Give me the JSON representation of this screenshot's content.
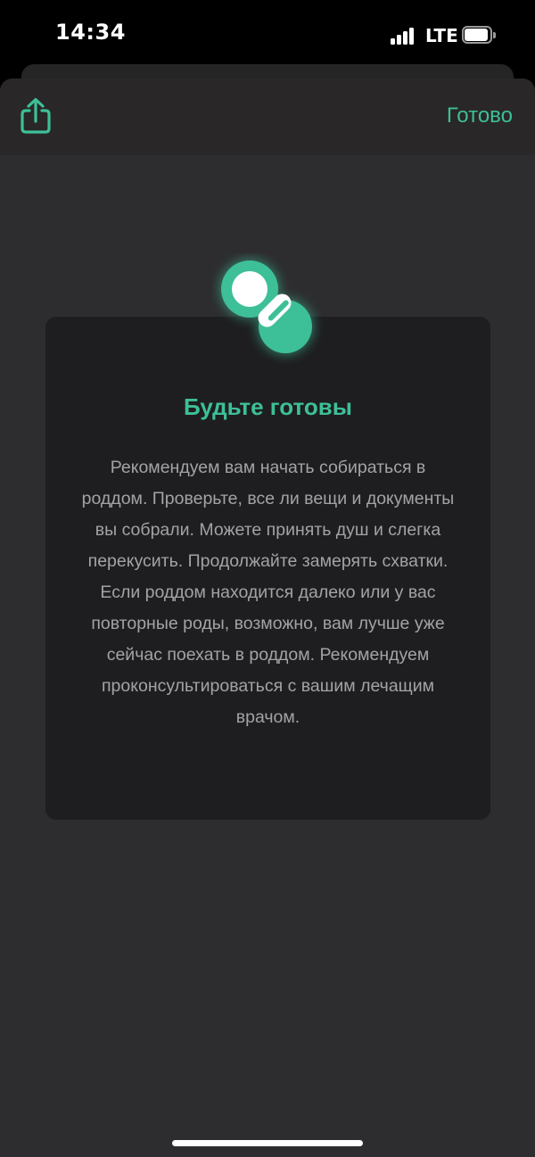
{
  "status_bar": {
    "time": "14:34",
    "network": "LTE",
    "signal_icon": "cellular-signal-icon",
    "battery_icon": "battery-icon"
  },
  "nav": {
    "share_icon": "share-icon",
    "done_label": "Готово"
  },
  "card": {
    "icon": "pacifier-icon",
    "title": "Будьте готовы",
    "body": "Рекомендуем вам начать собираться в роддом. Проверьте, все ли вещи и документы вы собрали. Можете принять душ и слегка перекусить. Продолжайте замерять схватки. Если роддом находится далеко или у вас повторные роды, возможно, вам лучше уже сейчас поехать в роддом. Рекомендуем проконсультироваться с вашим лечащим врачом."
  },
  "colors": {
    "accent": "#3dbf97",
    "background": "#2d2d2f",
    "card": "#1e1e20",
    "body_text": "#a3a3a6"
  }
}
